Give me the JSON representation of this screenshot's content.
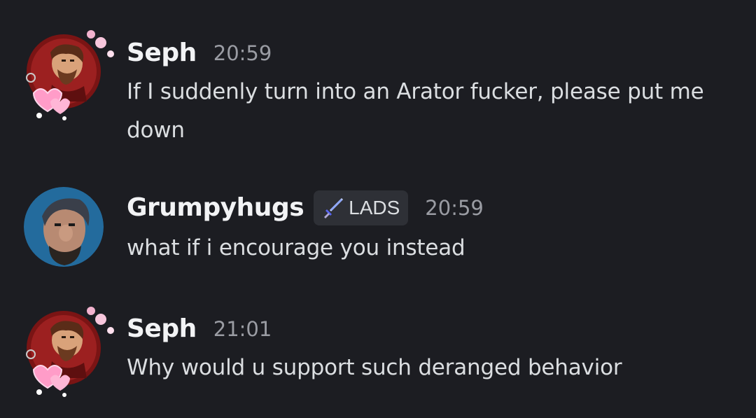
{
  "messages": [
    {
      "username": "Seph",
      "timestamp": "20:59",
      "text": "If I suddenly turn into an Arator fucker, please put me down",
      "avatar_icon": "character-avatar-with-hearts-decoration"
    },
    {
      "username": "Grumpyhugs",
      "tag": {
        "icon": "sword-icon",
        "label": "LADS"
      },
      "timestamp": "20:59",
      "text": "what if i encourage you instead",
      "avatar_icon": "user-avatar-photo"
    },
    {
      "username": "Seph",
      "timestamp": "21:01",
      "text": "Why would u support such deranged behavior",
      "avatar_icon": "character-avatar-with-hearts-decoration"
    }
  ],
  "colors": {
    "background": "#1c1d22",
    "username": "#f2f3f5",
    "message_text": "#dbdee1",
    "timestamp": "#9a9ca3",
    "tag_background": "#2e3036"
  }
}
